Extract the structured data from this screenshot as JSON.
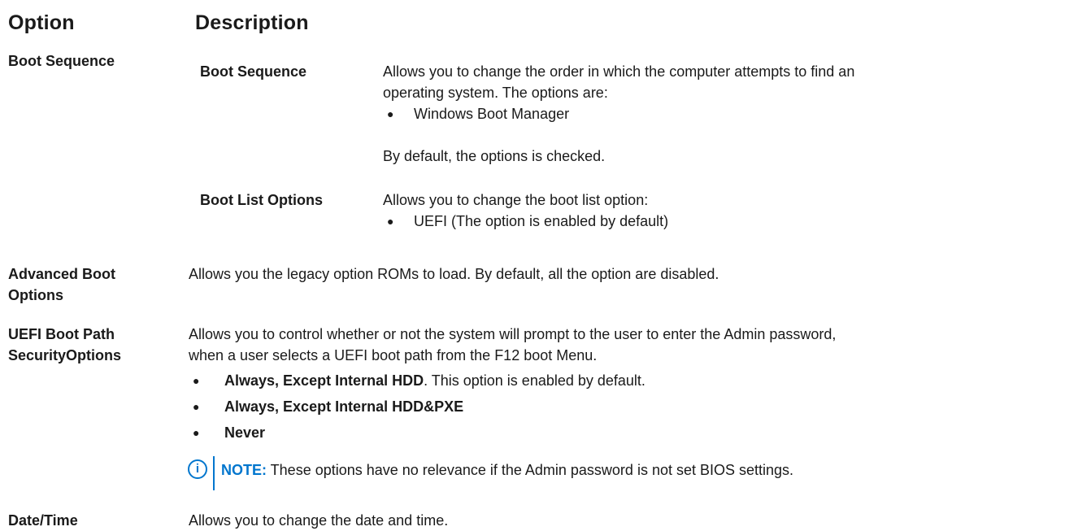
{
  "header": {
    "option": "Option",
    "description": "Description"
  },
  "rows": {
    "boot_sequence": {
      "option": "Boot Sequence",
      "sub_boot_sequence": {
        "label": "Boot Sequence",
        "line1": "Allows you to change the order in which the computer attempts to find an",
        "line2": "operating system. The options are:",
        "bullet1": "Windows Boot Manager",
        "default_text": "By default, the options is checked."
      },
      "sub_boot_list": {
        "label": "Boot List Options",
        "line1": "Allows you to change the boot list option:",
        "bullet1": "UEFI (The option is enabled by default)"
      }
    },
    "advanced_boot": {
      "option_line1": "Advanced Boot",
      "option_line2": "Options",
      "description": "Allows you the legacy option ROMs to load. By default, all the option are disabled."
    },
    "uefi_boot_path": {
      "option_line1": "UEFI Boot Path",
      "option_line2": "SecurityOptions",
      "line1": "Allows you to control whether or not the system will prompt to the user to enter the Admin password,",
      "line2": "when a user selects a UEFI boot path from the F12 boot Menu.",
      "bullet1_bold": "Always, Except Internal HDD",
      "bullet1_rest": ". This option is enabled by default.",
      "bullet2_bold": "Always, Except Internal HDD&PXE",
      "bullet3_bold": "Never",
      "note_icon": "i",
      "note_label": "NOTE:",
      "note_text": " These options have no relevance if the Admin password is not set BIOS settings."
    },
    "date_time": {
      "option": "Date/Time",
      "description": "Allows you to change the date and time."
    }
  },
  "bullet_glyph": "●",
  "colors": {
    "note_accent": "#0076ce",
    "text": "#1a1a1a"
  },
  "icons": {
    "note": "info-circle-icon",
    "bullet": "bullet-dot-icon"
  }
}
